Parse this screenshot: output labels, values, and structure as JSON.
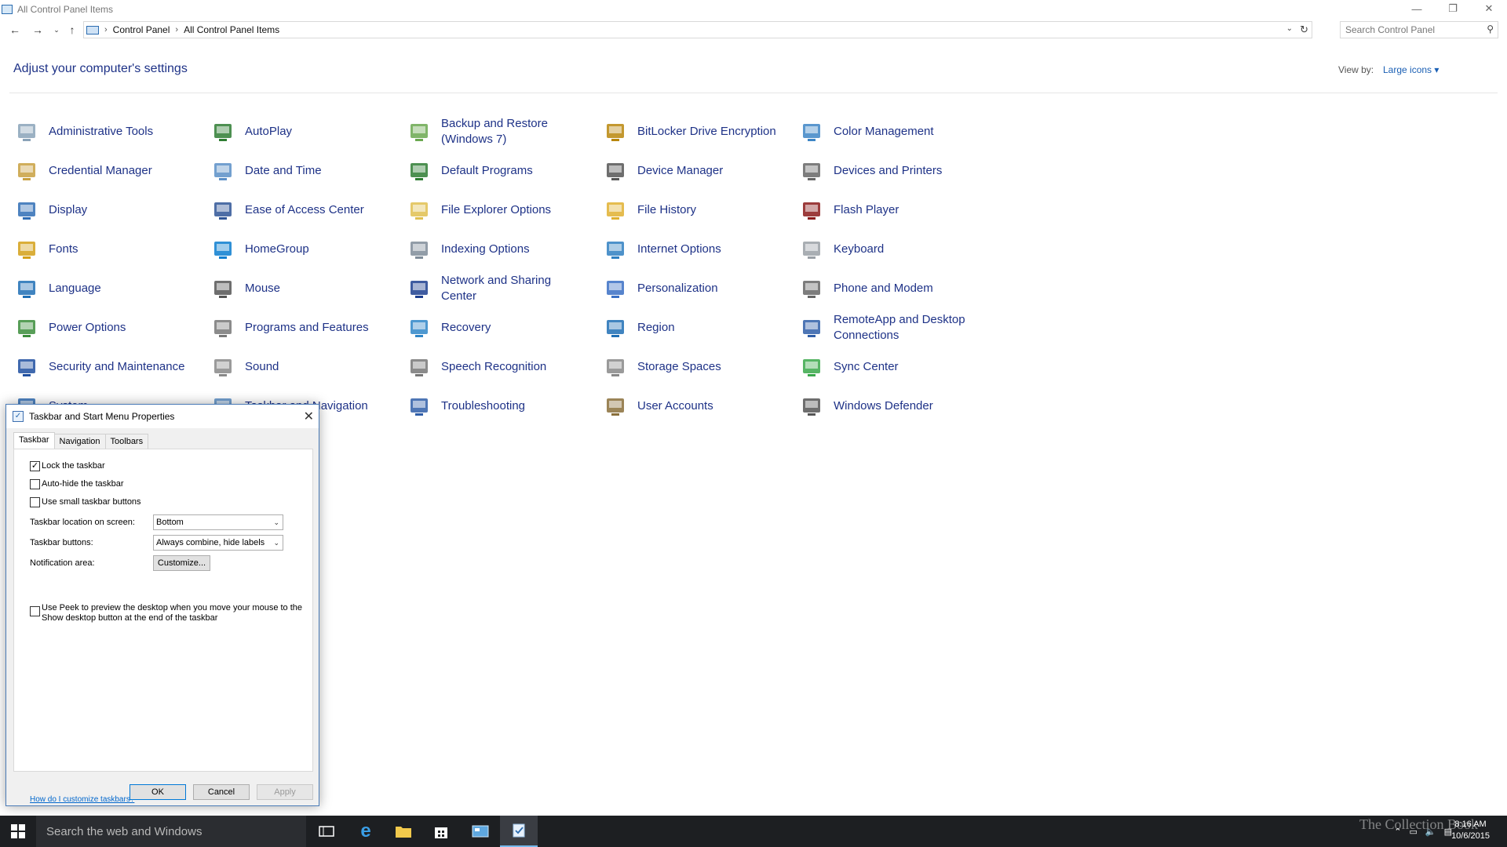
{
  "window": {
    "title": "All Control Panel Items",
    "minimize_icon": "minimize-icon",
    "restore_icon": "restore-icon",
    "close_icon": "close-icon"
  },
  "address": {
    "crumbs": [
      "Control Panel",
      "All Control Panel Items"
    ],
    "search_placeholder": "Search Control Panel"
  },
  "header": {
    "title": "Adjust your computer's settings",
    "view_by_label": "View by:",
    "view_by_value": "Large icons",
    "view_by_arrow": "▾"
  },
  "items": [
    [
      "Administrative Tools",
      "AutoPlay",
      "Backup and Restore (Windows 7)",
      "BitLocker Drive Encryption",
      "Color Management"
    ],
    [
      "Credential Manager",
      "Date and Time",
      "Default Programs",
      "Device Manager",
      "Devices and Printers"
    ],
    [
      "Display",
      "Ease of Access Center",
      "File Explorer Options",
      "File History",
      "Flash Player"
    ],
    [
      "Fonts",
      "HomeGroup",
      "Indexing Options",
      "Internet Options",
      "Keyboard"
    ],
    [
      "Language",
      "Mouse",
      "Network and Sharing Center",
      "Personalization",
      "Phone and Modem"
    ],
    [
      "Power Options",
      "Programs and Features",
      "Recovery",
      "Region",
      "RemoteApp and Desktop Connections"
    ],
    [
      "Security and Maintenance",
      "Sound",
      "Speech Recognition",
      "Storage Spaces",
      "Sync Center"
    ],
    [
      "System",
      "Taskbar and Navigation",
      "Troubleshooting",
      "User Accounts",
      "Windows Defender"
    ]
  ],
  "icon_colors": [
    [
      "#8aa3b8",
      "#2e7d32",
      "#6aa84f",
      "#b8860b",
      "#3d85c6"
    ],
    [
      "#c8a040",
      "#5b8fc7",
      "#2e7d32",
      "#555555",
      "#666666"
    ],
    [
      "#2f6db5",
      "#2f5597",
      "#e0c050",
      "#e0b030",
      "#8b1a1a"
    ],
    [
      "#d4a017",
      "#0b7dcf",
      "#7f8c99",
      "#2f7fc1",
      "#9aa0a6"
    ],
    [
      "#1f6fb5",
      "#555555",
      "#1d3f8f",
      "#3a6fc4",
      "#666666"
    ],
    [
      "#3b8d3b",
      "#777777",
      "#2f86c8",
      "#1f6fb5",
      "#2f5ea8"
    ],
    [
      "#1f4fa0",
      "#888888",
      "#777777",
      "#888888",
      "#3aa84a"
    ],
    [
      "#2f6db5",
      "#5b8fc7",
      "#2f5ea8",
      "#8a6f3a",
      "#555555"
    ]
  ],
  "dialog": {
    "title": "Taskbar and Start Menu Properties",
    "tabs": [
      "Taskbar",
      "Navigation",
      "Toolbars"
    ],
    "lock_taskbar": "Lock the taskbar",
    "auto_hide": "Auto-hide the taskbar",
    "small_buttons": "Use small taskbar buttons",
    "location_label": "Taskbar location on screen:",
    "location_value": "Bottom",
    "buttons_label": "Taskbar buttons:",
    "buttons_value": "Always combine, hide labels",
    "notification_label": "Notification area:",
    "customize_button": "Customize...",
    "peek_text": "Use Peek to preview the desktop when you move your mouse to the Show desktop button at the end of the taskbar",
    "help_link": "How do I customize taskbars?",
    "ok": "OK",
    "cancel": "Cancel",
    "apply": "Apply",
    "checkmark": "✓",
    "lock_checked": true,
    "auto_hide_checked": false,
    "small_checked": false,
    "peek_checked": false
  },
  "taskbar": {
    "search_placeholder": "Search the web and Windows",
    "time": "8:16 AM",
    "date": "10/6/2015",
    "watermark": "The Collection Book"
  }
}
